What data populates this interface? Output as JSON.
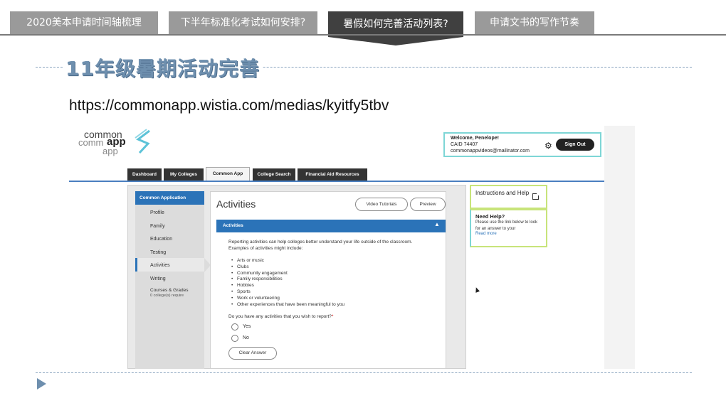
{
  "slide": {
    "tabs": [
      {
        "label": "2020美本申请时间轴梳理"
      },
      {
        "label": "下半年标准化考试如何安排?"
      },
      {
        "label": "暑假如何完善活动列表?"
      },
      {
        "label": "申请文书的写作节奏"
      }
    ],
    "heading": "11年级暑期活动完善",
    "url": "https://commonapp.wistia.com/medias/kyitfy5tbv",
    "colors": {
      "tab": "#9a9a9a",
      "tab_active": "#404040",
      "heading": "#6e8fae",
      "accent": "#2b73b8"
    }
  },
  "shot": {
    "logo": {
      "line1": "common",
      "line2": "comm",
      "line2b": "app",
      "line3": "app"
    },
    "welcome": {
      "greeting": "Welcome, Penelope!",
      "caid": "CAID 74407",
      "email": "commonappvideos@mailinator.com"
    },
    "icons": {
      "gear": "⚙",
      "caret_up": "▲"
    },
    "sign_out": "Sign Out",
    "nav_tabs": [
      "Dashboard",
      "My Colleges",
      "Common App",
      "College Search",
      "Financial Aid Resources"
    ],
    "sidebar": {
      "header": "Common Application",
      "items": [
        "Profile",
        "Family",
        "Education",
        "Testing",
        "Activities",
        "Writing",
        "Courses & Grades"
      ],
      "courses_sub": "0 college(s) require"
    },
    "main": {
      "title": "Activities",
      "video_tutorials": "Video Tutorials",
      "preview": "Preview",
      "section_header": "Activities",
      "intro": "Reporting activities can help colleges better understand your life outside of the classroom. Examples of activities might include:",
      "examples": [
        "Arts or music",
        "Clubs",
        "Community engagement",
        "Family responsibilities",
        "Hobbies",
        "Sports",
        "Work or volunteering",
        "Other experiences that have been meaningful to you"
      ],
      "question": "Do you have any activities that you wish to report?",
      "required_mark": "*",
      "options": [
        "Yes",
        "No"
      ],
      "clear_answer": "Clear Answer"
    },
    "help": {
      "instructions": "Instructions and Help",
      "need_help": "Need Help?",
      "need_help_body": "Please use the link below to look for an answer to your",
      "read_more": "Read more"
    }
  }
}
